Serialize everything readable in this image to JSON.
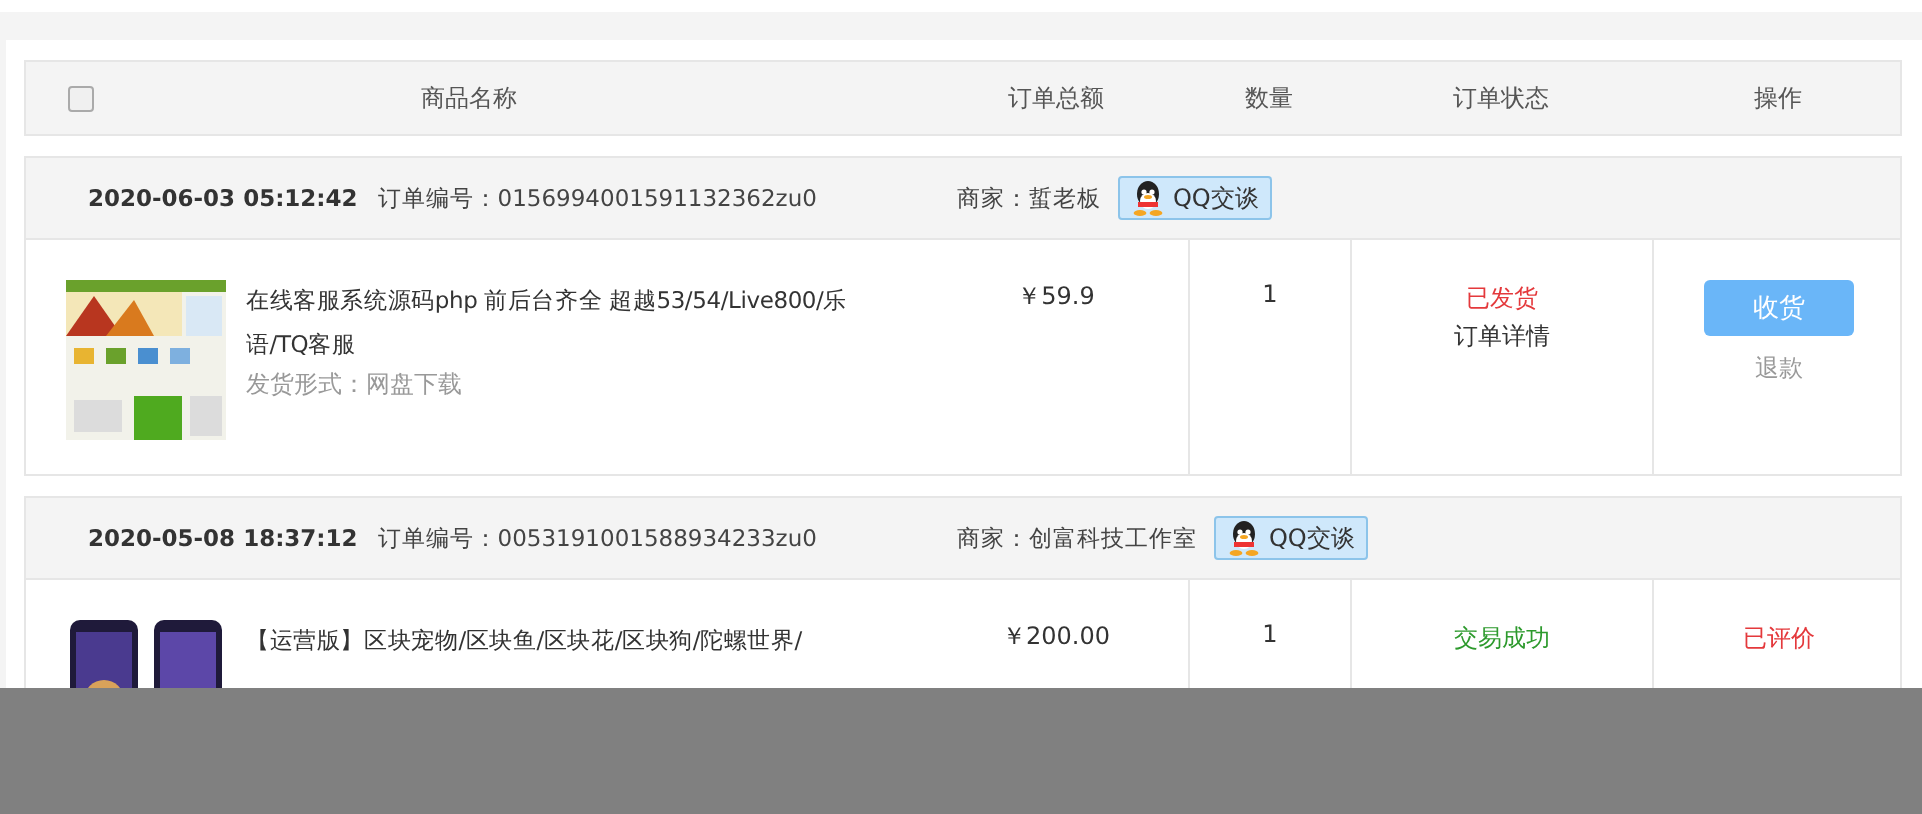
{
  "table": {
    "select_all": {
      "checked": false
    },
    "columns": [
      "商品名称",
      "订单总额",
      "数量",
      "订单状态",
      "操作"
    ]
  },
  "orders": [
    {
      "time": "2020-06-03 05:12:42",
      "order_no": "订单编号：0156994001591132362zu0",
      "seller": "商家：蜇老板",
      "chat_button": "QQ交谈",
      "item": {
        "title": "在线客服系统源码php 前后台齐全 超越53/54/Live800/乐语/TQ客服",
        "delivery": "发货形式：网盘下载",
        "price": "￥59.9",
        "quantity": "1",
        "status": {
          "text": "已发货",
          "color": "#e4393c"
        },
        "details_link": "订单详情",
        "actions": [
          {
            "kind": "button",
            "label": "收货"
          },
          {
            "kind": "link",
            "label": "退款"
          }
        ]
      }
    },
    {
      "time": "2020-05-08 18:37:12",
      "order_no": "订单编号：0053191001588934233zu0",
      "seller": "商家：创富科技工作室",
      "chat_button": "QQ交谈",
      "item": {
        "title": "【运营版】区块宠物/区块鱼/区块花/区块狗/陀螺世界/",
        "price": "￥200.00",
        "quantity": "1",
        "status": {
          "text": "交易成功",
          "color": "#2d9a2d"
        },
        "actions": [
          {
            "kind": "note",
            "label": "已评价"
          }
        ]
      }
    }
  ]
}
